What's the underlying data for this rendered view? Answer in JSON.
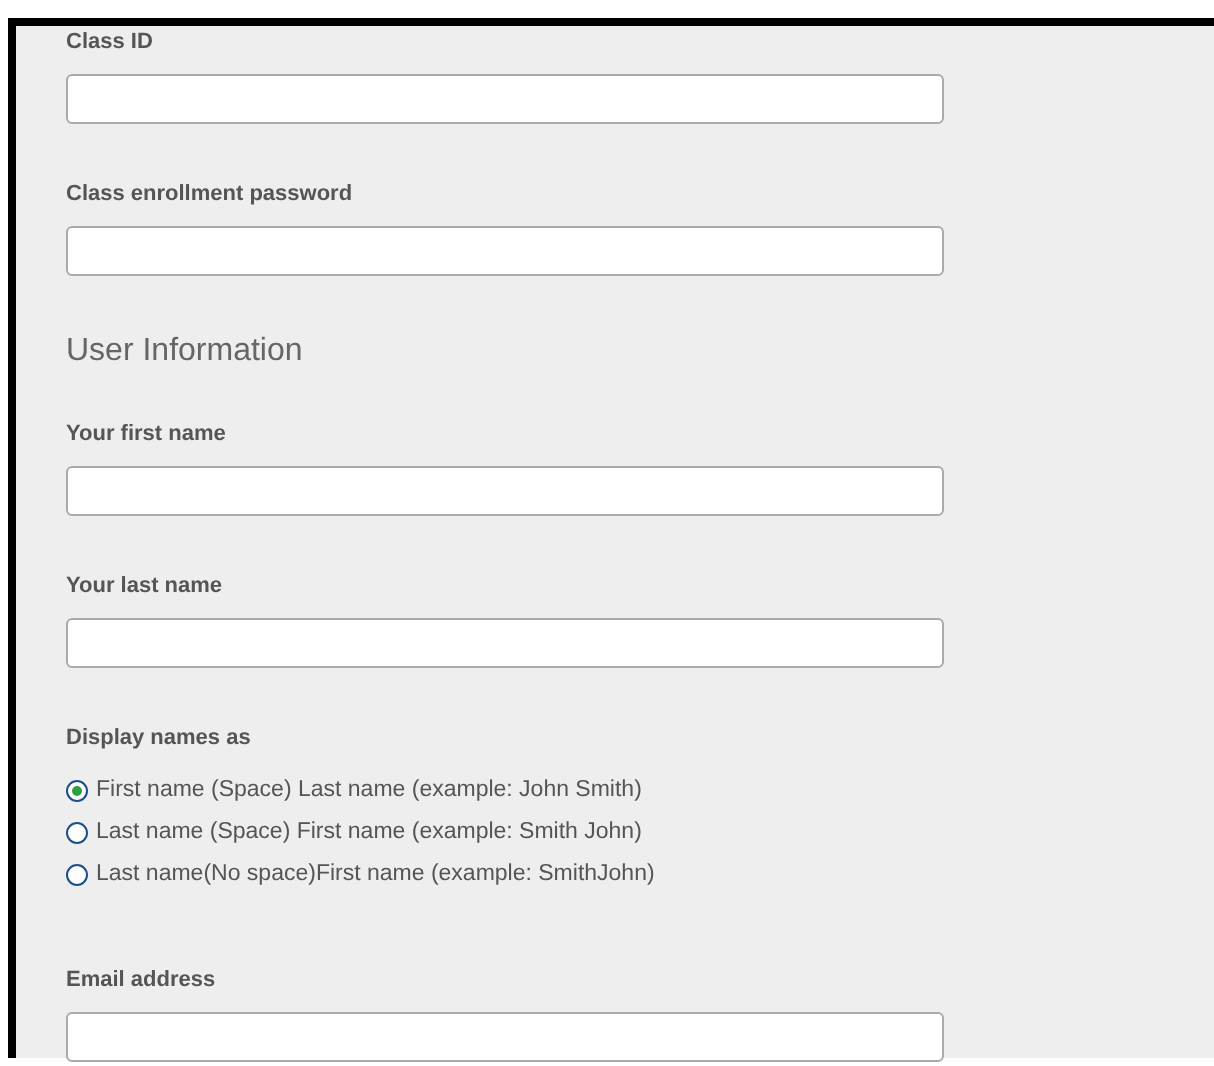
{
  "form": [
    {
      "kind": "field",
      "label": "Class ID"
    },
    {
      "kind": "field",
      "label": "Class enrollment password"
    },
    {
      "kind": "heading",
      "text": "User Information"
    },
    {
      "kind": "field",
      "label": "Your first name"
    },
    {
      "kind": "field",
      "label": "Your last name"
    },
    {
      "kind": "radios",
      "label": "Display names as",
      "options": [
        {
          "label": "First name (Space) Last name (example: John Smith)",
          "selected": true
        },
        {
          "label": "Last name (Space) First name (example: Smith John)",
          "selected": false
        },
        {
          "label": "Last name(No space)First name (example: SmithJohn)",
          "selected": false
        }
      ]
    },
    {
      "kind": "field",
      "label": "Email address"
    }
  ]
}
